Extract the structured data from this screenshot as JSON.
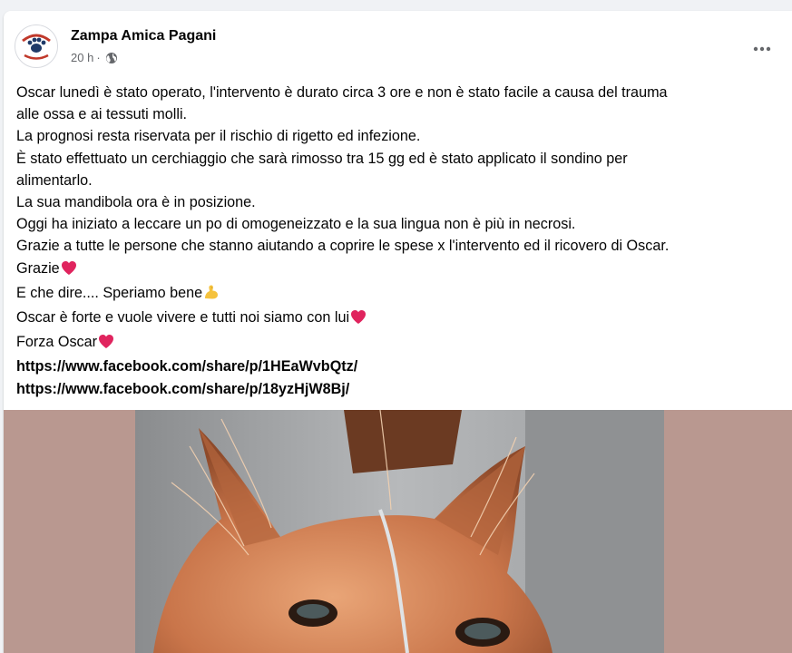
{
  "post": {
    "author": "Zampa Amica Pagani",
    "timestamp": "20 h",
    "separator": "·",
    "audience_icon": "globe-icon",
    "menu_icon": "more-options-icon",
    "lines": [
      "Oscar lunedì è stato operato, l'intervento è durato circa 3 ore e non è stato facile a causa del trauma",
      "alle ossa e ai tessuti molli.",
      "La prognosi resta riservata per il rischio di rigetto ed infezione.",
      "È stato effettuato un cerchiaggio che sarà rimosso tra 15 gg ed è stato applicato il sondino per",
      "alimentarlo.",
      "La sua mandibola ora è in posizione.",
      "Oggi ha iniziato a leccare un po di omogeneizzato e la sua lingua non è più in necrosi.",
      "Grazie a tutte le persone che stanno  aiutando a coprire le spese x l'intervento ed il ricovero di Oscar.",
      "Grazie",
      "E che dire.... Speriamo bene",
      "Oscar è forte e vuole vivere e tutti noi siamo con lui",
      "Forza Oscar"
    ],
    "links": [
      "https://www.facebook.com/share/p/1HEaWvbQtz/",
      "https://www.facebook.com/share/p/18yzHjW8Bj/"
    ],
    "emojis": {
      "heart": "red-heart-emoji",
      "muscle": "flexed-biceps-emoji"
    },
    "media": {
      "background_color": "#b99890"
    }
  }
}
